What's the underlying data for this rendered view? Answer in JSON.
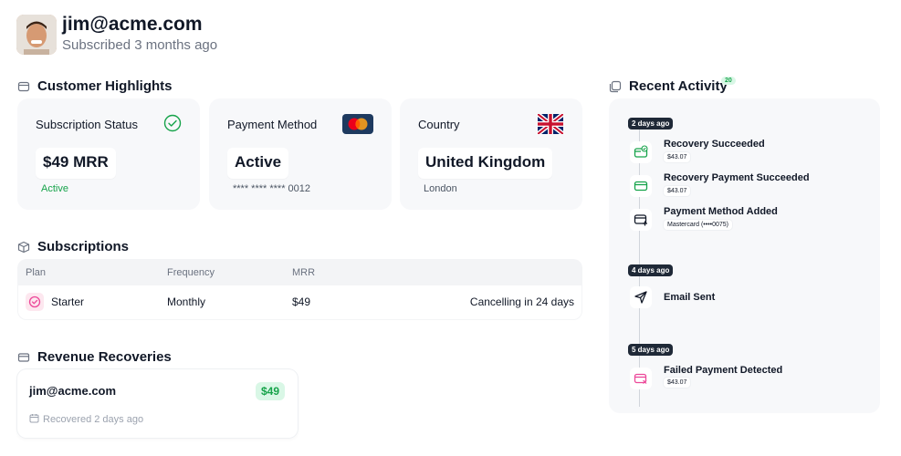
{
  "header": {
    "email": "jim@acme.com",
    "subtitle": "Subscribed 3 months ago"
  },
  "highlights": {
    "title": "Customer Highlights",
    "cards": [
      {
        "label": "Subscription Status",
        "value": "$49 MRR",
        "foot": "Active",
        "icon": "check-circle-icon"
      },
      {
        "label": "Payment Method",
        "value": "Active",
        "foot": "**** **** **** 0012",
        "icon": "mastercard-icon"
      },
      {
        "label": "Country",
        "value": "United Kingdom",
        "foot": "London",
        "icon": "uk-flag-icon"
      }
    ]
  },
  "subscriptions": {
    "title": "Subscriptions",
    "columns": [
      "Plan",
      "Frequency",
      "MRR"
    ],
    "rows": [
      {
        "plan": "Starter",
        "frequency": "Monthly",
        "mrr": "$49",
        "status": "Cancelling in 24 days"
      }
    ]
  },
  "recoveries": {
    "title": "Revenue Recoveries",
    "items": [
      {
        "email": "jim@acme.com",
        "amount": "$49",
        "foot": "Recovered 2 days ago"
      }
    ]
  },
  "activity": {
    "title": "Recent Activity",
    "count": "20",
    "groups": [
      {
        "date": "2 days ago",
        "events": [
          {
            "title": "Recovery Succeeded",
            "meta": "$43.07",
            "icon": "card-check-icon"
          },
          {
            "title": "Recovery Payment Succeeded",
            "meta": "$43.07",
            "icon": "card-icon"
          },
          {
            "title": "Payment Method Added",
            "meta": "Mastercard (••••0075)",
            "icon": "card-add-icon"
          }
        ]
      },
      {
        "date": "4 days ago",
        "events": [
          {
            "title": "Email Sent",
            "meta": "",
            "icon": "send-icon"
          }
        ]
      },
      {
        "date": "5 days ago",
        "events": [
          {
            "title": "Failed Payment Detected",
            "meta": "$43.07",
            "icon": "card-x-icon"
          }
        ]
      }
    ]
  },
  "colors": {
    "green": "#16a34a",
    "pink": "#ec4899",
    "card_bg": "#f7f8fa",
    "dark": "#1f2937"
  }
}
